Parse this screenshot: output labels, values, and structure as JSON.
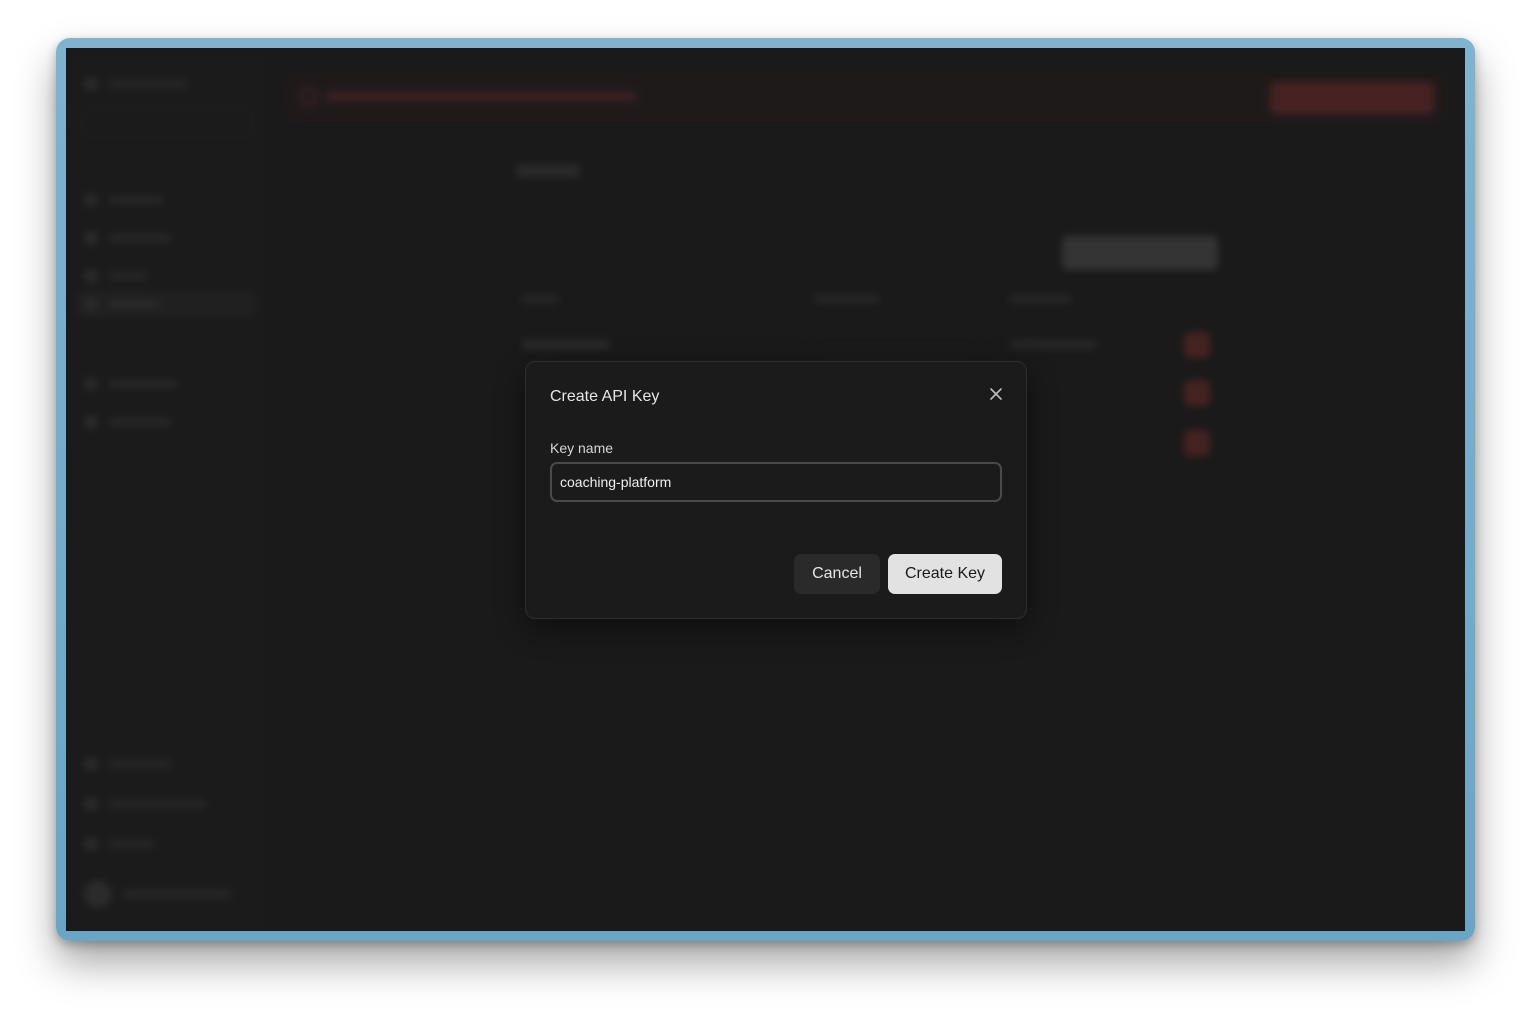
{
  "dialog": {
    "title": "Create API Key",
    "field_label": "Key name",
    "input_value": "coaching-platform",
    "cancel_label": "Cancel",
    "create_label": "Create Key",
    "close_icon": "close-icon"
  },
  "colors": {
    "frame": "#6aa5c6",
    "window_bg": "#1a1a1a",
    "dialog_bg": "#1b1b1b",
    "primary_button_bg": "#e2e2e2",
    "secondary_button_bg": "#2a2a2a"
  }
}
